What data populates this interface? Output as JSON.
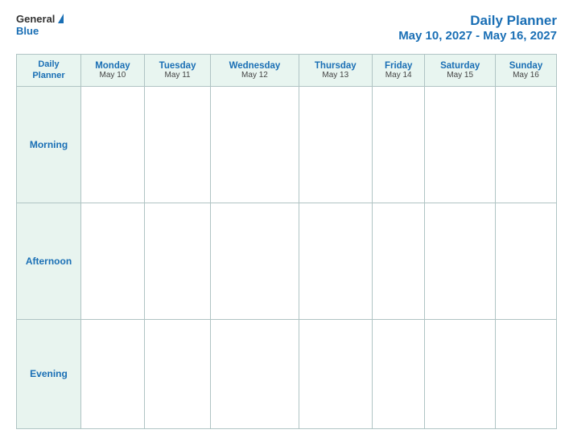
{
  "header": {
    "logo_general": "General",
    "logo_blue": "Blue",
    "title_main": "Daily Planner",
    "title_date": "May 10, 2027 - May 16, 2027"
  },
  "table": {
    "col_header": {
      "label_line1": "Daily",
      "label_line2": "Planner"
    },
    "days": [
      {
        "name": "Monday",
        "date": "May 10"
      },
      {
        "name": "Tuesday",
        "date": "May 11"
      },
      {
        "name": "Wednesday",
        "date": "May 12"
      },
      {
        "name": "Thursday",
        "date": "May 13"
      },
      {
        "name": "Friday",
        "date": "May 14"
      },
      {
        "name": "Saturday",
        "date": "May 15"
      },
      {
        "name": "Sunday",
        "date": "May 16"
      }
    ],
    "rows": [
      {
        "label": "Morning"
      },
      {
        "label": "Afternoon"
      },
      {
        "label": "Evening"
      }
    ]
  }
}
